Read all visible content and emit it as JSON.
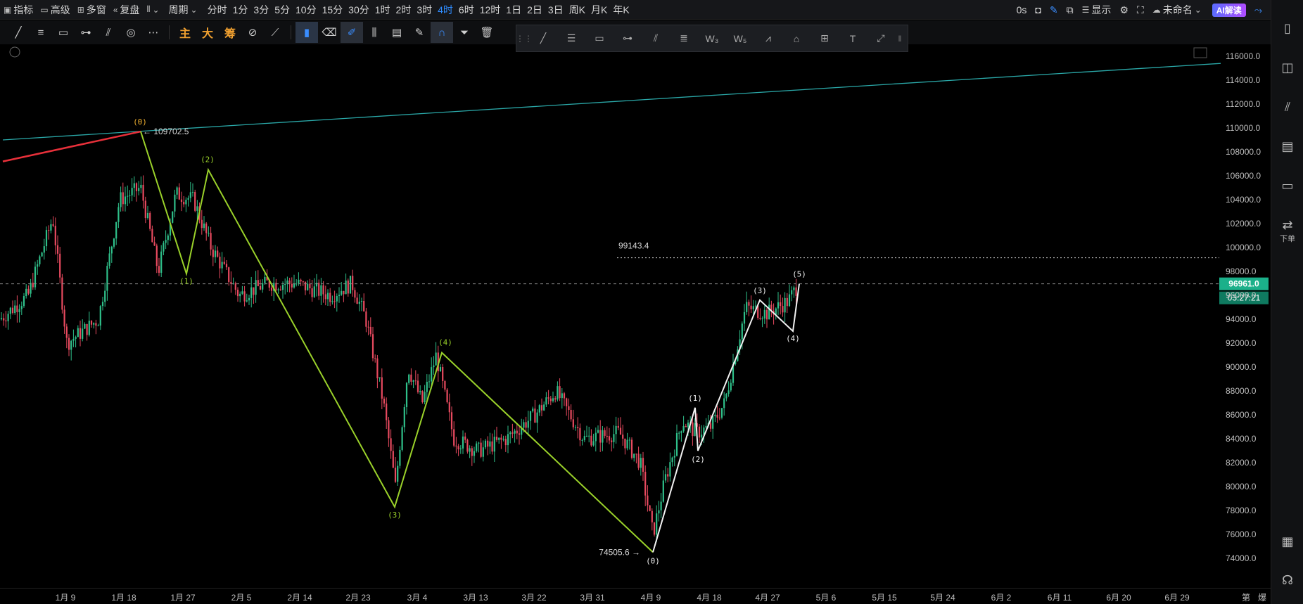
{
  "toolbar": {
    "indicators": "指标",
    "advanced": "高级",
    "multi_window": "多窗",
    "restore": "复盘",
    "period_menu": "周期",
    "periods": [
      "分时",
      "1分",
      "3分",
      "5分",
      "10分",
      "15分",
      "30分",
      "1时",
      "2时",
      "3时",
      "4时",
      "6时",
      "12时",
      "1日",
      "2日",
      "3日",
      "周K",
      "月K",
      "年K"
    ],
    "active_period": "4时",
    "countdown": "0s",
    "display": "显示",
    "unnamed": "未命名",
    "ai": "AI解读"
  },
  "drawbar": {
    "main": "主",
    "big": "大",
    "chips": "筹"
  },
  "sidebar": {
    "order": "下单"
  },
  "chart": {
    "price_axis": [
      "116000.0",
      "114000.0",
      "112000.0",
      "110000.0",
      "108000.0",
      "106000.0",
      "104000.0",
      "102000.0",
      "100000.0",
      "98000.0",
      "96000.0",
      "94000.0",
      "92000.0",
      "90000.0",
      "88000.0",
      "86000.0",
      "84000.0",
      "82000.0",
      "80000.0",
      "78000.0",
      "76000.0",
      "74000.0"
    ],
    "last_price": "96961.0",
    "countdown": "03:27:21",
    "level_label": "99143.4",
    "high_label": "← 109702.5",
    "low_label": "74505.6 →",
    "x_axis": [
      "1月 9",
      "1月 18",
      "1月 27",
      "2月 5",
      "2月 14",
      "2月 23",
      "3月 4",
      "3月 13",
      "3月 22",
      "3月 31",
      "4月 9",
      "4月 18",
      "4月 27",
      "5月 6",
      "5月 15",
      "5月 24",
      "6月 2",
      "6月 11",
      "6月 20",
      "6月 29"
    ],
    "corner_labels": [
      "第",
      "爆"
    ],
    "green_wave_labels": [
      "(0)",
      "(1)",
      "(2)",
      "(3)",
      "(4)"
    ],
    "white_wave_labels": [
      "(0)",
      "(1)",
      "(2)",
      "(3)",
      "(4)",
      "(5)"
    ],
    "colors": {
      "up": "#2fc08a",
      "down": "#e84a5f",
      "green_wave": "#9ad12a",
      "white_wave": "#f2f2f2",
      "trendline": "#2aa8a8",
      "red_line": "#e8303a",
      "price_tag": "#1bb08a",
      "wave0_label": "#f0b030"
    }
  }
}
